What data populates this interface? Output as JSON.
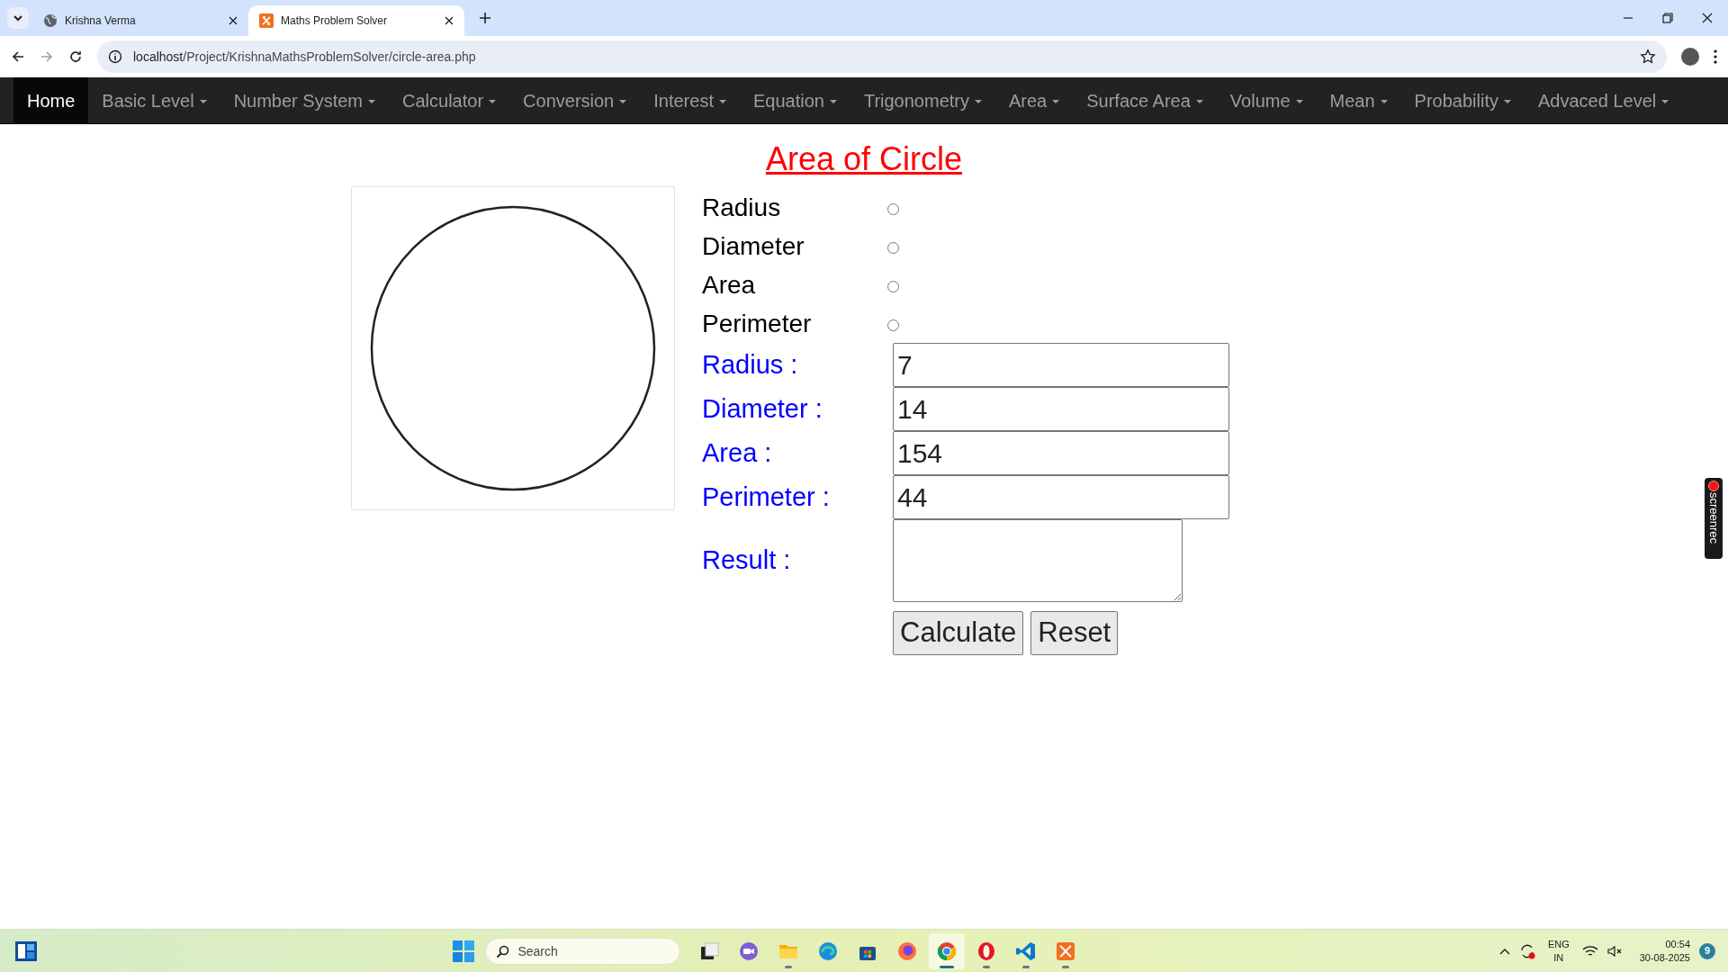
{
  "browser": {
    "tabs": [
      {
        "title": "Krishna Verma",
        "selected": false,
        "kind": "globe"
      },
      {
        "title": "Maths Problem Solver",
        "selected": true,
        "kind": "xampp"
      }
    ],
    "url_host": "localhost",
    "url_path": "/Project/KrishnaMathsProblemSolver/circle-area.php"
  },
  "navbar": {
    "items": [
      {
        "label": "Home",
        "selected": true,
        "dropdown": false
      },
      {
        "label": "Basic Level",
        "selected": false,
        "dropdown": true
      },
      {
        "label": "Number System",
        "selected": false,
        "dropdown": true
      },
      {
        "label": "Calculator",
        "selected": false,
        "dropdown": true
      },
      {
        "label": "Conversion",
        "selected": false,
        "dropdown": true
      },
      {
        "label": "Interest",
        "selected": false,
        "dropdown": true
      },
      {
        "label": "Equation",
        "selected": false,
        "dropdown": true
      },
      {
        "label": "Trigonometry",
        "selected": false,
        "dropdown": true
      },
      {
        "label": "Area",
        "selected": false,
        "dropdown": true
      },
      {
        "label": "Surface Area",
        "selected": false,
        "dropdown": true
      },
      {
        "label": "Volume",
        "selected": false,
        "dropdown": true
      },
      {
        "label": "Mean",
        "selected": false,
        "dropdown": true
      },
      {
        "label": "Probability",
        "selected": false,
        "dropdown": true
      },
      {
        "label": "Advaced Level",
        "selected": false,
        "dropdown": true
      }
    ]
  },
  "page": {
    "title": "Area of Circle",
    "find_options": [
      {
        "label": "Radius",
        "selected": false
      },
      {
        "label": "Diameter",
        "selected": false
      },
      {
        "label": "Area",
        "selected": false
      },
      {
        "label": "Perimeter",
        "selected": false
      }
    ],
    "fields": [
      {
        "label": "Radius :",
        "value": "7"
      },
      {
        "label": "Diameter :",
        "value": "14"
      },
      {
        "label": "Area :",
        "value": "154"
      },
      {
        "label": "Perimeter :",
        "value": "44"
      }
    ],
    "result": {
      "label": "Result :"
    },
    "buttons": [
      "Calculate",
      "Reset"
    ]
  },
  "recorder_badge": {
    "label": "screenrec"
  },
  "taskbar": {
    "search_placeholder": "Search",
    "apps": [
      {
        "kind": "taskview",
        "running": false,
        "selected": false
      },
      {
        "kind": "meet",
        "running": false,
        "selected": false
      },
      {
        "kind": "folder",
        "running": true,
        "selected": false
      },
      {
        "kind": "edge",
        "running": false,
        "selected": false
      },
      {
        "kind": "store",
        "running": false,
        "selected": false
      },
      {
        "kind": "firefox",
        "running": false,
        "selected": false
      },
      {
        "kind": "chrome",
        "running": true,
        "selected": true
      },
      {
        "kind": "opera",
        "running": true,
        "selected": false
      },
      {
        "kind": "vscode",
        "running": true,
        "selected": false
      },
      {
        "kind": "xampp",
        "running": true,
        "selected": false
      }
    ],
    "tray": {
      "language": "ENG",
      "region": "IN",
      "time": "00:54",
      "date": "30-08-2025",
      "notifications": "9"
    }
  }
}
